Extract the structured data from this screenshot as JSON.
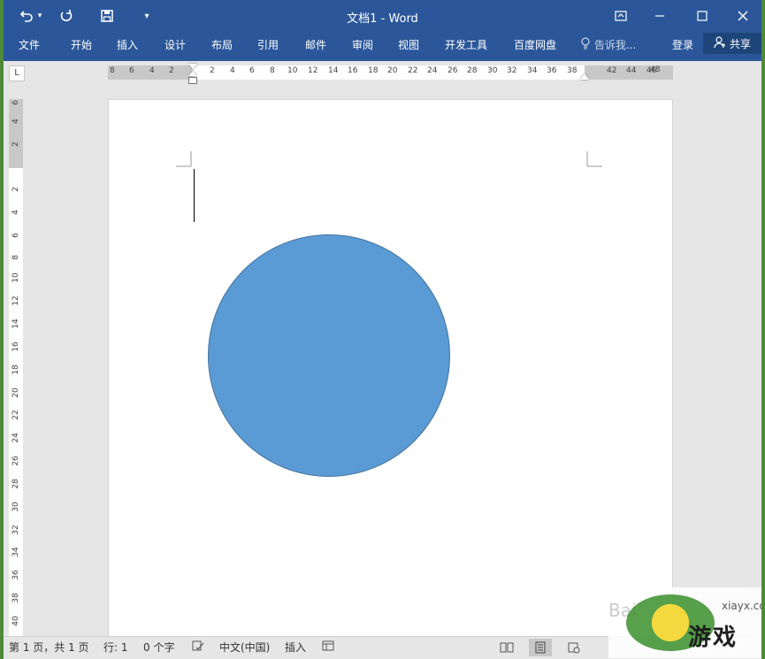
{
  "window": {
    "title": "文档1 - Word",
    "accent_color": "#2b579a"
  },
  "quick_access": {
    "undo_icon": "undo-icon",
    "redo_icon": "redo-icon",
    "save_icon": "save-icon",
    "customize_icon": "customize-qat-icon"
  },
  "ribbon": {
    "tabs": [
      "文件",
      "开始",
      "插入",
      "设计",
      "布局",
      "引用",
      "邮件",
      "审阅",
      "视图",
      "开发工具",
      "百度网盘"
    ],
    "tell_me": "告诉我...",
    "sign_in": "登录",
    "share": "共享"
  },
  "ruler": {
    "corner_label": "L",
    "left_ticks": [
      "8",
      "6",
      "4",
      "2"
    ],
    "right_ticks": [
      "2",
      "4",
      "6",
      "8",
      "10",
      "12",
      "14",
      "16",
      "18",
      "20",
      "22",
      "24",
      "26",
      "28",
      "30",
      "32",
      "34",
      "36",
      "38",
      "42",
      "44",
      "46",
      "48"
    ],
    "vertical_top": [
      "6",
      "4",
      "2"
    ],
    "vertical_ticks": [
      "2",
      "4",
      "6",
      "8",
      "10",
      "12",
      "14",
      "16",
      "18",
      "20",
      "22",
      "24",
      "26",
      "28",
      "30",
      "32",
      "34",
      "36",
      "38",
      "40"
    ]
  },
  "document": {
    "shape": "circle",
    "shape_fill": "#5b9bd5",
    "shape_outline": "#41719c"
  },
  "status": {
    "page": "第 1 页，共 1 页",
    "line": "行: 1",
    "words": "0 个字",
    "language": "中文(中国)",
    "mode": "插入"
  },
  "watermark": {
    "url": "xiayx.com",
    "text": "游戏",
    "baidu": "Bai"
  }
}
